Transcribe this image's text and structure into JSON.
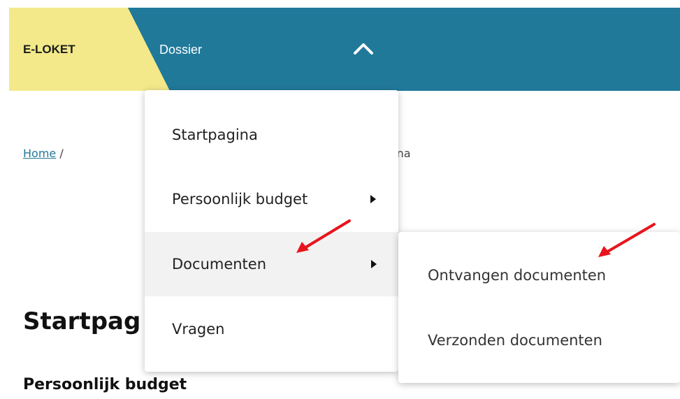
{
  "header": {
    "brand": "E-LOKET",
    "nav_link": "Dossier",
    "chevron_icon": "chevron-up-icon"
  },
  "breadcrumb": {
    "home": "Home",
    "separator": "/",
    "current_fragment": "gina"
  },
  "page": {
    "title": "Startpag",
    "section": "Persoonlijk budget"
  },
  "menu": {
    "items": [
      {
        "label": "Startpagina",
        "has_submenu": false
      },
      {
        "label": "Persoonlijk budget",
        "has_submenu": true
      },
      {
        "label": "Documenten",
        "has_submenu": true,
        "active": true
      },
      {
        "label": "Vragen",
        "has_submenu": false
      }
    ]
  },
  "submenu": {
    "items": [
      {
        "label": "Ontvangen documenten"
      },
      {
        "label": "Verzonden documenten"
      }
    ]
  },
  "colors": {
    "nav": "#21799a",
    "brand": "#f3e98a",
    "annotation": "#e8141c"
  }
}
